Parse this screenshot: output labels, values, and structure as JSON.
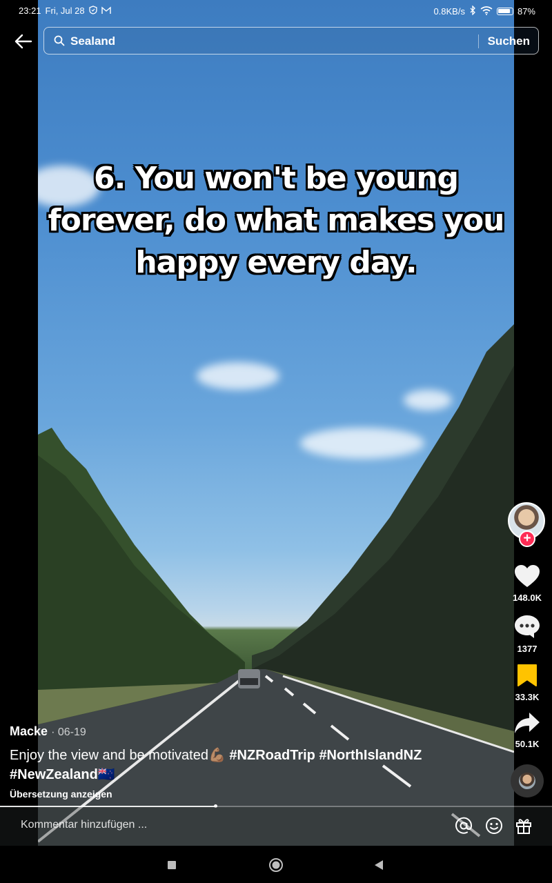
{
  "status_bar": {
    "time": "23:21",
    "date": "Fri, Jul 28",
    "network_speed": "0.8KB/s",
    "battery_percent": "87%",
    "battery_level": 0.87,
    "icons": [
      "shield-icon",
      "mail-icon",
      "bluetooth-icon",
      "wifi-icon",
      "battery-icon"
    ]
  },
  "search": {
    "query": "Sealand",
    "submit_label": "Suchen"
  },
  "video": {
    "overlay_text": "6. You won't be young forever, do what makes you happy every day.",
    "progress": 0.39
  },
  "creator": {
    "author": "Macke",
    "date": "· 06-19",
    "follow_symbol": "+"
  },
  "actions": {
    "likes": "148.0K",
    "comments": "1377",
    "saves": "33.3K",
    "shares": "50.1K"
  },
  "caption": {
    "text": "Enjoy the view and be motivated💪🏽",
    "hashtags": [
      "#NZRoadTrip",
      "#NorthIslandNZ",
      "#NewZealand🇳🇿"
    ],
    "translate_label": "Übersetzung anzeigen"
  },
  "comment_bar": {
    "placeholder": "Kommentar hinzufügen ...",
    "icons": [
      "mention-icon",
      "emoji-icon",
      "gift-icon"
    ]
  },
  "colors": {
    "accent": "#fe2c55",
    "save_active": "#ffc300"
  }
}
